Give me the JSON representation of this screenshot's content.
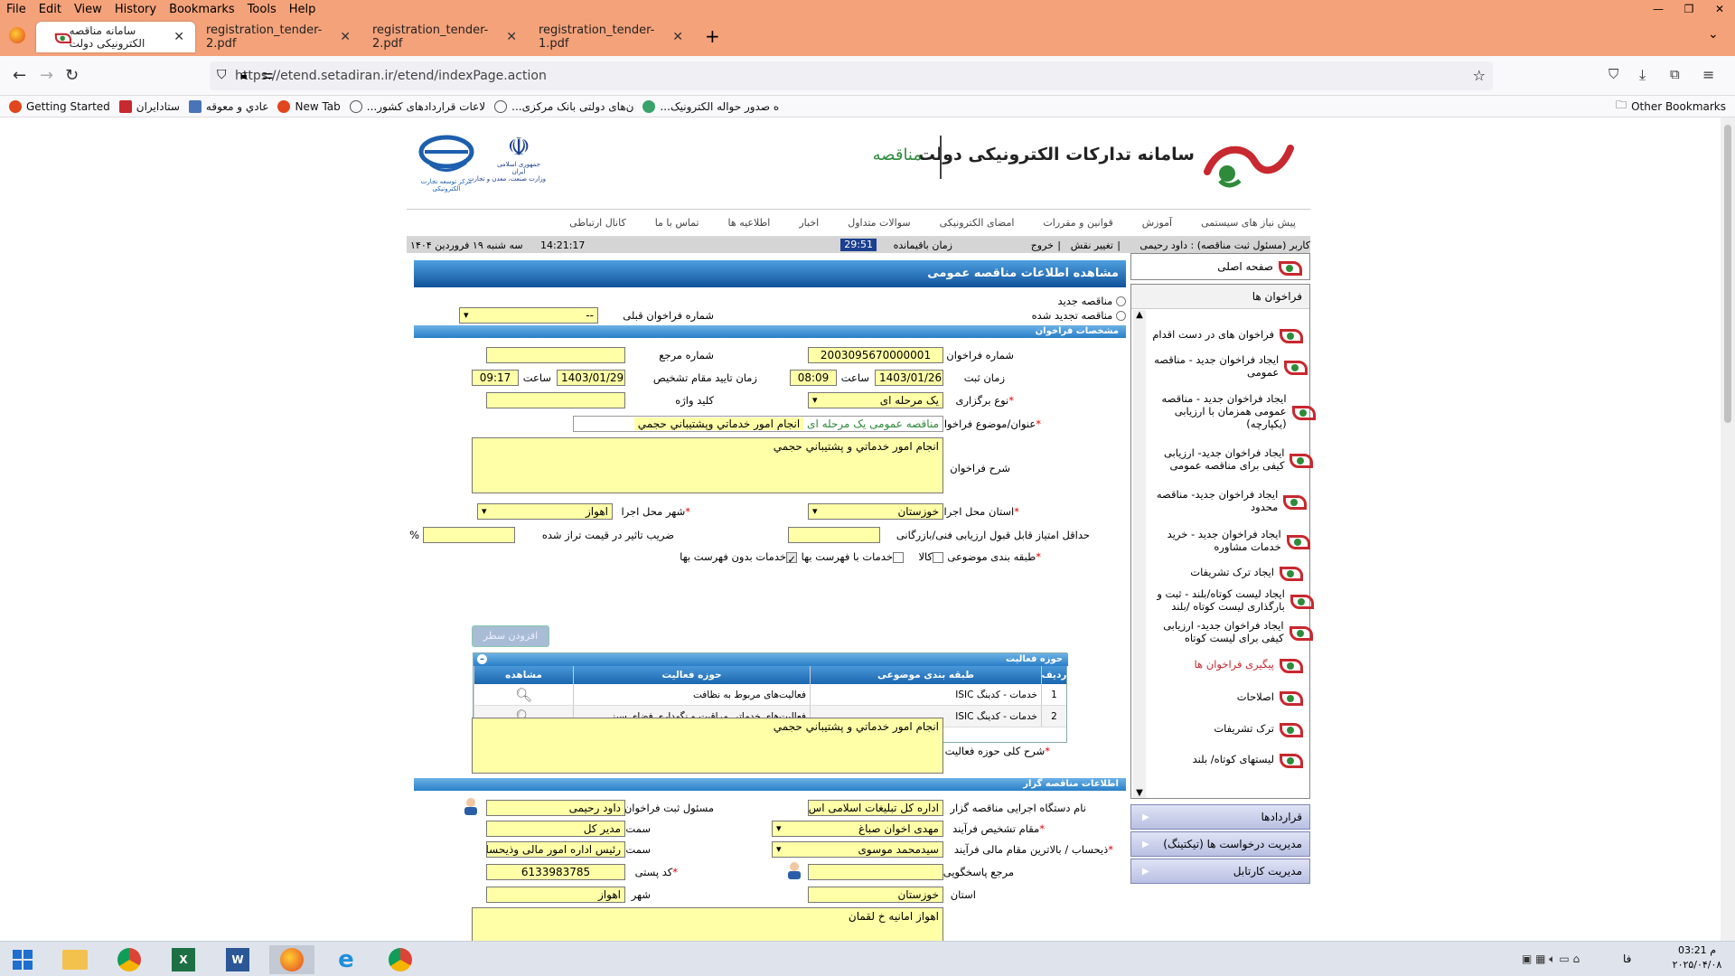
{
  "browser": {
    "menu": [
      "File",
      "Edit",
      "View",
      "History",
      "Bookmarks",
      "Tools",
      "Help"
    ],
    "tabs": [
      {
        "label": "سامانه مناقصه الکترونیکی دولت",
        "active": true
      },
      {
        "label": "registration_tender-2.pdf",
        "active": false
      },
      {
        "label": "registration_tender-2.pdf",
        "active": false
      },
      {
        "label": "registration_tender-1.pdf",
        "active": false
      }
    ],
    "url": "https://etend.setadiran.ir/etend/indexPage.action",
    "bookmarks": [
      "Getting Started",
      "ستادایران",
      "عادي و معوقه",
      "New Tab",
      "...لاعات قراردادهای کشور",
      "...ن‌های دولتی بانک مرکزی",
      "...ه صدور حواله الکترونیک"
    ],
    "other_bookmarks": "Other Bookmarks"
  },
  "header": {
    "system_title": "سامانه تدارکات الکترونیکی دولت",
    "section": "مناقصه",
    "emblem_text_1": "جمهوری اسلامی ایران",
    "emblem_text_2": "وزارت صنعت، معدن و تجارت",
    "center_logo_text": "مرکز توسعه تجارت الکترونیکی"
  },
  "nav": [
    "پیش نیاز های سیستمی",
    "آموزش",
    "قوانین و مقررات",
    "امضای الکترونیکی",
    "سوالات متداول",
    "اخبار",
    "اطلاعیه ها",
    "تماس با ما",
    "کانال ارتباطی"
  ],
  "status": {
    "user": "کاربر (مسئول ثبت مناقصه) : داود رحیمی",
    "change_role": "تغییر نقش",
    "logout": "خروج",
    "remaining_label": "زمان باقیمانده",
    "remaining_value": "29:51",
    "time": "14:21:17",
    "date": "سه شنبه ۱۹ فروردین ۱۴۰۴"
  },
  "sidebar": {
    "home": "صفحه اصلی",
    "calls_header": "فراخوان ها",
    "items": [
      "فراخوان های در دست اقدام",
      "ایجاد فراخوان جدید - مناقصه عمومی",
      "ایجاد فراخوان جدید - مناقصه عمومی همزمان با ارزیابی (یکپارچه)",
      "ایجاد فراخوان جدید- ارزیابی کیفی برای مناقصه عمومی",
      "ایجاد فراخوان جدید- مناقصه محدود",
      "ایجاد فراخوان جدید - خرید خدمات مشاوره",
      "ایجاد ترک تشریفات",
      "ایجاد لیست کوتاه/بلند - ثبت و بارگذاری لیست کوتاه /بلند",
      "ایجاد فراخوان جدید- ارزیابی کیفی برای لیست کوتاه",
      "پیگیری فراخوان ها",
      "اصلاحات",
      "ترک تشریفات",
      "لیستهای کوتاه/ بلند"
    ],
    "accordions": [
      "قراردادها",
      "مدیریت درخواست ها (تیکتینگ)",
      "مدیریت کارتابل"
    ]
  },
  "form": {
    "page_title": "مشاهده اطلاعات مناقصه عمومی",
    "radio_new": "مناقصه جدید",
    "radio_renewed": "مناقصه تجدید شده",
    "prev_call_label": "شماره فراخوان قبلی",
    "prev_call_value": "--",
    "sec_call_spec": "مشخصات فراخوان",
    "call_number_label": "شماره فراخوان",
    "call_number": "2003095670000001",
    "ref_number_label": "شماره مرجع",
    "ref_number": "",
    "reg_time_label": "زمان ثبت",
    "reg_date": "1403/01/26",
    "hour_label": "ساعت",
    "reg_hour": "08:09",
    "approve_time_label": "زمان تایید مقام تشخیص",
    "approve_date": "1403/01/29",
    "approve_hour": "09:17",
    "holding_type_label": "نوع برگزاری",
    "holding_type": "یک مرحله ای",
    "keyword_label": "کلید واژه",
    "keyword": "",
    "subject_label": "عنوان/موضوع فراخوان",
    "subject_prefix": "مناقصه عمومی یک مرحله ای",
    "subject": "انجام امور خدماتي وپشتيباني حجمي",
    "desc_label": "شرح فراخوان",
    "desc": "انجام امور خدماتي و پشتيباني حجمي",
    "province_label": "استان محل اجرا",
    "province": "خوزستان",
    "city_label": "شهر محل اجرا",
    "city": "اهواز",
    "min_score_label": "حداقل امتیاز قابل قبول ارزیابی فنی/بازرگانی",
    "min_score": "",
    "impact_label": "ضریب تاثیر در قیمت تراز شده",
    "impact": "",
    "percent": "%",
    "category_label": "طبقه بندی موضوعی",
    "cat_goods": "کالا",
    "cat_services_price": "خدمات با فهرست بها",
    "cat_services_noprice": "خدمات بدون فهرست بها",
    "add_row": "افزودن سطر",
    "activity_title": "حوزه فعالیت",
    "activity_cols": [
      "ردیف",
      "طبقه بندی موضوعی",
      "حوزه فعالیت",
      "مشاهده"
    ],
    "activity_rows": [
      {
        "idx": "1",
        "category": "خدمات - کدینگ ISIC",
        "field": "فعالیت‌های مربوط به نظافت"
      },
      {
        "idx": "2",
        "category": "خدمات - کدینگ ISIC",
        "field": "فعالیت‌های خدماتی مراقبت و نگهداری فضای سبز"
      }
    ],
    "activity_desc_label": "شرح کلی حوزه فعالیت",
    "activity_desc": "انجام امور خدماتي و پشتيباني حجمي",
    "sec_tenderer": "اطلاعات مناقصه گزار",
    "org_label": "نام دستگاه اجرایی مناقصه گزار",
    "org": "اداره کل تبلیغات اسلامی اس",
    "responsible_label": "مسئول ثبت فراخوان",
    "responsible": "داود رحیمی",
    "authority_label": "مقام تشخیص فرآیند",
    "authority": "مهدی اخوان صباغ",
    "post_label": "سمت",
    "post1": "مدیر کل",
    "beneficiary_label": "ذیحساب / بالاترین مقام مالی فرآیند",
    "beneficiary": "سیدمحمد موسوی",
    "post2": "رئیس اداره امور مالی وذیحسا",
    "answer_ref_label": "مرجع پاسخگویی",
    "answer_ref": "",
    "postal_label": "کد پستی",
    "postal": "6133983785",
    "province2_label": "استان",
    "province2": "خوزستان",
    "city2_label": "شهر",
    "city2": "اهواز",
    "address": "اهواز امانیه خ لقمان"
  },
  "taskbar": {
    "lang": "فا",
    "time": "03:21 م",
    "date": "۲۰۲۵/۰۴/۰۸"
  },
  "colors": {
    "chrome": "#f4a27a",
    "field": "#ffffa8",
    "section_blue": "#2a7fc8",
    "accent_green": "#2e8b3a",
    "accent_red": "#c8282f"
  }
}
